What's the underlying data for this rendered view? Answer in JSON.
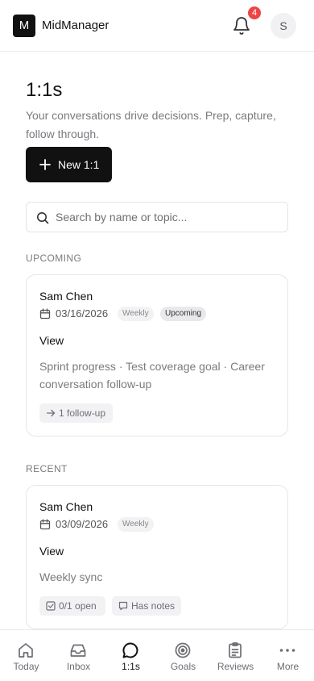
{
  "header": {
    "logo_letter": "M",
    "app_name": "MidManager",
    "notification_count": "4",
    "avatar_initial": "S"
  },
  "main": {
    "title": "1:1s",
    "subtitle": "Your conversations drive decisions. Prep, capture, follow through.",
    "new_button_label": "New 1:1",
    "search_placeholder": "Search by name or topic..."
  },
  "upcoming": {
    "label": "UPCOMING",
    "cards": [
      {
        "name": "Sam Chen",
        "date": "03/16/2026",
        "cadence": "Weekly",
        "status": "Upcoming",
        "view_label": "View",
        "topics": "Sprint progress · Test coverage goal · Career conversation follow-up",
        "followup": "1 follow-up"
      }
    ]
  },
  "recent": {
    "label": "RECENT",
    "cards": [
      {
        "name": "Sam Chen",
        "date": "03/09/2026",
        "cadence": "Weekly",
        "view_label": "View",
        "topics": "Weekly sync",
        "open_items": "0/1 open",
        "notes": "Has notes"
      }
    ]
  },
  "nav": {
    "active": "1:1s",
    "items": [
      {
        "label": "Today",
        "icon": "home-icon"
      },
      {
        "label": "Inbox",
        "icon": "inbox-icon"
      },
      {
        "label": "1:1s",
        "icon": "chat-icon"
      },
      {
        "label": "Goals",
        "icon": "target-icon"
      },
      {
        "label": "Reviews",
        "icon": "clipboard-icon"
      },
      {
        "label": "More",
        "icon": "more-icon"
      }
    ]
  }
}
